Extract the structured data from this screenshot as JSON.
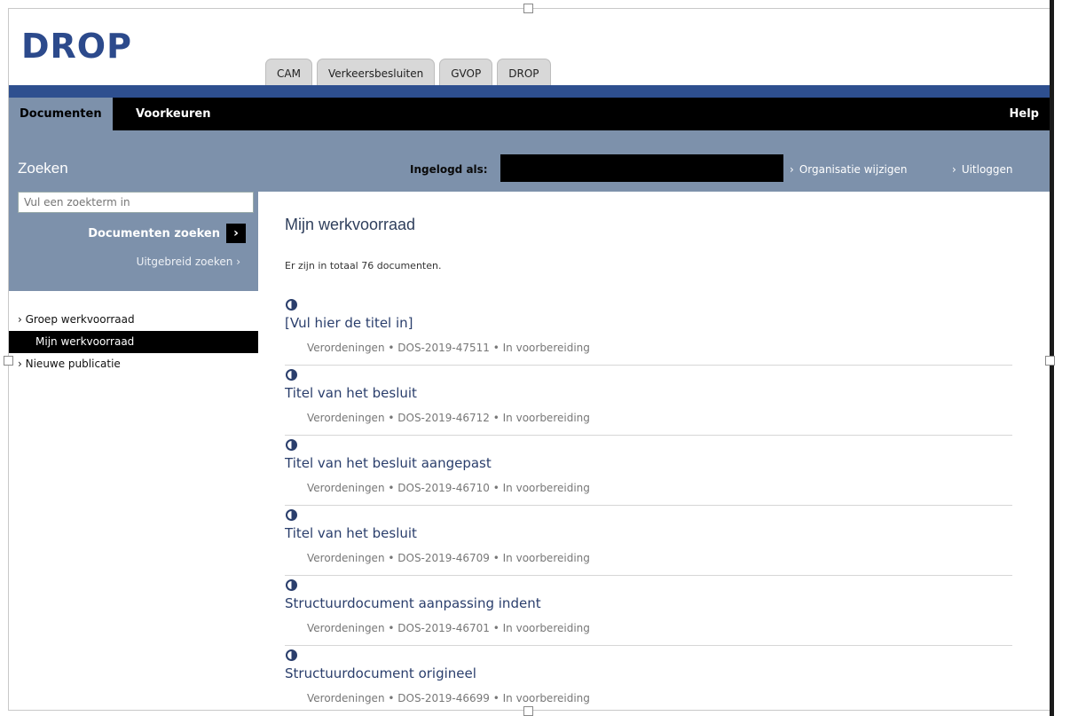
{
  "app": {
    "logo": "DROP"
  },
  "tabs": [
    "CAM",
    "Verkeersbesluiten",
    "GVOP",
    "DROP"
  ],
  "menu": {
    "documents": "Documenten",
    "preferences": "Voorkeuren",
    "help": "Help"
  },
  "search_bar": {
    "title": "Zoeken",
    "logged_in_label": "Ingelogd als:",
    "change_org": "Organisatie wijzigen",
    "logout": "Uitloggen"
  },
  "search": {
    "placeholder": "Vul een zoekterm in",
    "button": "Documenten zoeken",
    "advanced": "Uitgebreid zoeken"
  },
  "sidebar": {
    "items": [
      {
        "label": "Groep werkvoorraad",
        "active": false
      },
      {
        "label": "Mijn werkvoorraad",
        "active": true
      },
      {
        "label": "Nieuwe publicatie",
        "active": false
      }
    ]
  },
  "main": {
    "title": "Mijn werkvoorraad",
    "total": "Er zijn in totaal 76 documenten.",
    "documents": [
      {
        "title": "[Vul hier de titel in]",
        "meta": "Verordeningen • DOS-2019-47511 • In voorbereiding"
      },
      {
        "title": "Titel van het besluit",
        "meta": "Verordeningen • DOS-2019-46712 • In voorbereiding"
      },
      {
        "title": "Titel van het besluit aangepast",
        "meta": "Verordeningen • DOS-2019-46710 • In voorbereiding"
      },
      {
        "title": "Titel van het besluit",
        "meta": "Verordeningen • DOS-2019-46709 • In voorbereiding"
      },
      {
        "title": "Structuurdocument aanpassing indent",
        "meta": "Verordeningen • DOS-2019-46701 • In voorbereiding"
      },
      {
        "title": "Structuurdocument origineel",
        "meta": "Verordeningen • DOS-2019-46699 • In voorbereiding"
      }
    ]
  },
  "icons": {
    "status": "half-circle-icon",
    "chevron": "chevron-right-icon"
  }
}
